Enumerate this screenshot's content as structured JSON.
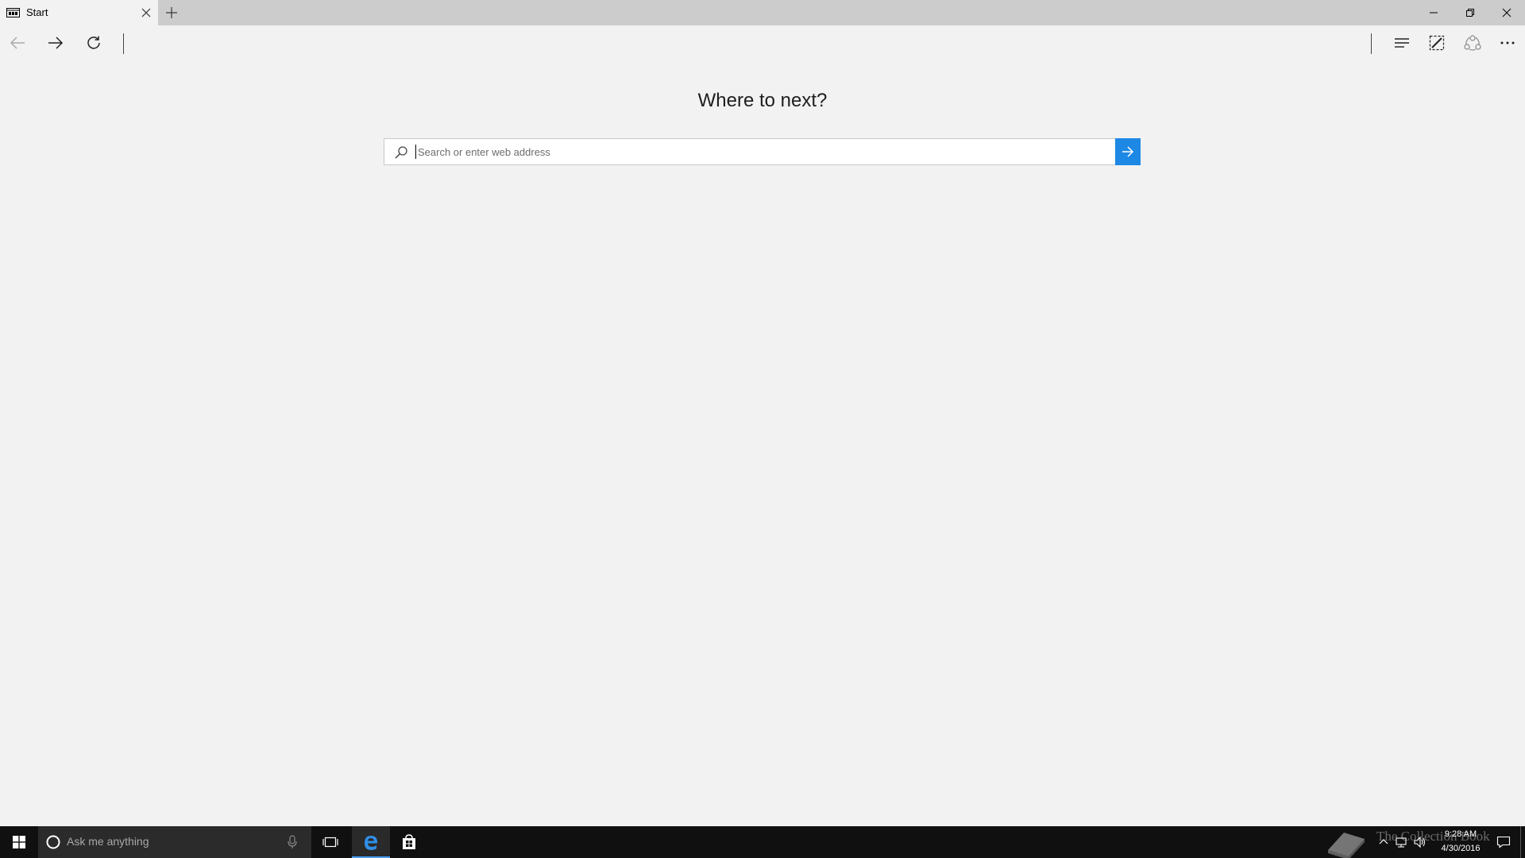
{
  "tab": {
    "title": "Start"
  },
  "page": {
    "heading": "Where to next?",
    "search_placeholder": "Search or enter web address"
  },
  "taskbar": {
    "cortana_text": "Ask me anything",
    "clock_time": "9:28 AM",
    "clock_date": "4/30/2016",
    "watermark": "The Collection Book"
  },
  "colors": {
    "accent": "#1e88e5",
    "tabbar": "#cccccc",
    "background": "#f2f2f2",
    "taskbar": "#101010"
  },
  "icons": {
    "tab_page": "tab-page-icon",
    "close_tab": "close-icon",
    "new_tab": "plus-icon",
    "back": "arrow-left-icon",
    "forward": "arrow-right-icon",
    "refresh": "refresh-icon",
    "hub": "hub-icon",
    "web_note": "pen-icon",
    "share": "share-icon",
    "more": "more-icon",
    "search": "search-icon",
    "go": "arrow-right-icon"
  }
}
